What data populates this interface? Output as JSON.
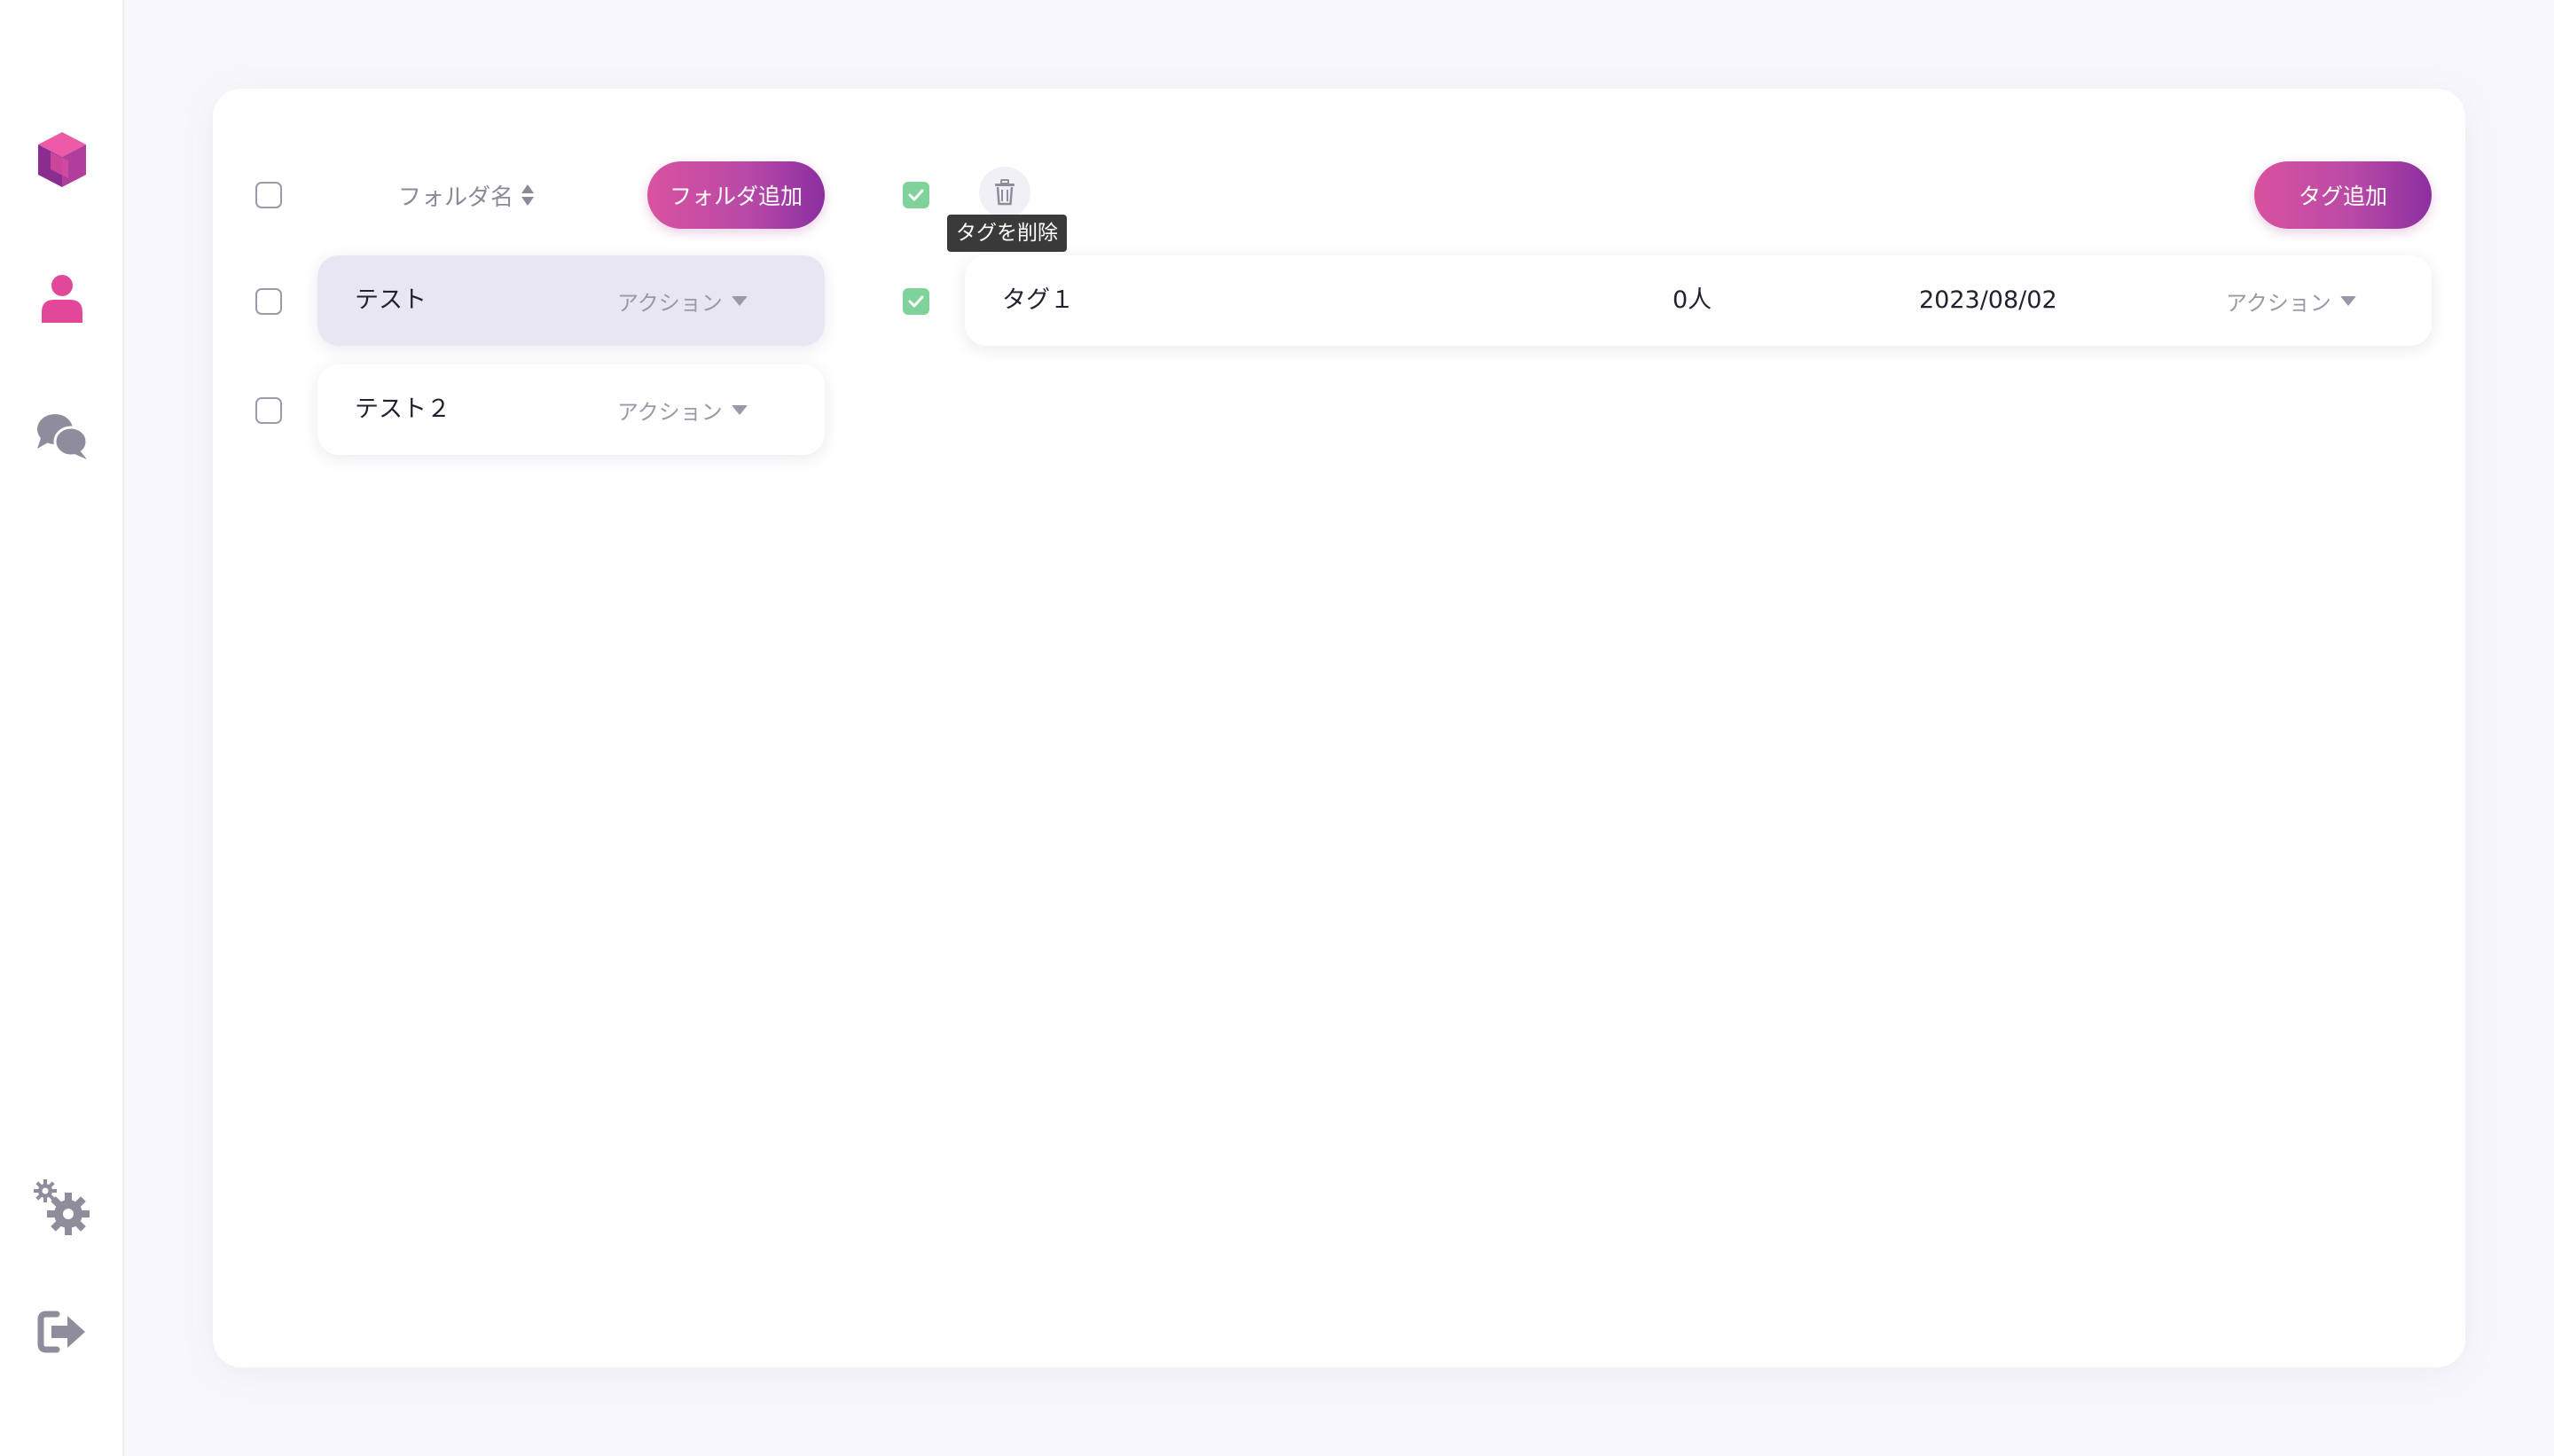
{
  "sidebar": {
    "items": [
      {
        "name": "logo",
        "icon": "cube-logo-icon"
      },
      {
        "name": "users",
        "icon": "user-icon",
        "active": true
      },
      {
        "name": "chats",
        "icon": "chat-bubbles-icon"
      },
      {
        "name": "settings",
        "icon": "gears-icon"
      },
      {
        "name": "logout",
        "icon": "sign-out-icon"
      }
    ],
    "accent_color": "#e2479a",
    "icon_color": "#8f8d9c"
  },
  "folders": {
    "header_label": "フォルダ名",
    "add_button_label": "フォルダ追加",
    "rows": [
      {
        "name": "テスト",
        "action_label": "アクション",
        "selected": true
      },
      {
        "name": "テスト２",
        "action_label": "アクション",
        "selected": false
      }
    ]
  },
  "tags": {
    "add_button_label": "タグ追加",
    "delete_tooltip": "タグを削除",
    "rows": [
      {
        "name": "タグ１",
        "count": "0人",
        "date": "2023/08/02",
        "action_label": "アクション",
        "checked": true
      }
    ]
  },
  "colors": {
    "button_gradient_start": "#d9529f",
    "button_gradient_end": "#8b2fa0",
    "checkbox_checked": "#7fd39a",
    "selected_row": "#e9e6f4"
  }
}
